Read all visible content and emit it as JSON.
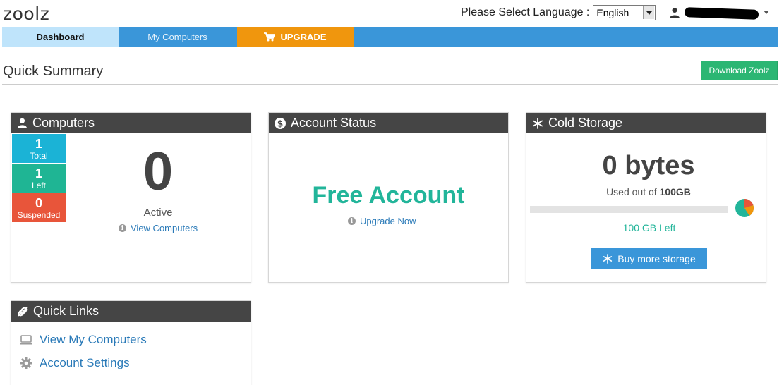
{
  "header": {
    "logo": "zoolz",
    "language_label": "Please Select Language :",
    "language_selected": "English"
  },
  "nav": {
    "tabs": [
      {
        "label": "Dashboard",
        "active": true
      },
      {
        "label": "My Computers",
        "active": false
      },
      {
        "label": "UPGRADE",
        "active": false
      }
    ]
  },
  "page": {
    "title": "Quick Summary",
    "download_button": "Download Zoolz"
  },
  "computers": {
    "title": "Computers",
    "stats": [
      {
        "value": "1",
        "label": "Total",
        "color": "#1bb3d6"
      },
      {
        "value": "1",
        "label": "Left",
        "color": "#1fb594"
      },
      {
        "value": "0",
        "label": "Suspended",
        "color": "#e8553a"
      }
    ],
    "active_count": "0",
    "active_label": "Active",
    "link": "View Computers"
  },
  "account": {
    "title": "Account Status",
    "status": "Free Account",
    "link": "Upgrade Now"
  },
  "cold_storage": {
    "title": "Cold Storage",
    "used": "0 bytes",
    "used_prefix": "Used out of",
    "total": "100GB",
    "left": "100 GB Left",
    "used_fraction": 0,
    "button": "Buy more storage"
  },
  "quick_links": {
    "title": "Quick Links",
    "items": [
      {
        "label": "View My Computers",
        "icon": "laptop-icon"
      },
      {
        "label": "Account Settings",
        "icon": "gear-icon"
      }
    ]
  },
  "colors": {
    "nav_blue": "#3a96d9",
    "upgrade_orange": "#f0960d",
    "green": "#2bb673",
    "teal": "#22b59a",
    "panel_header": "#454545"
  }
}
